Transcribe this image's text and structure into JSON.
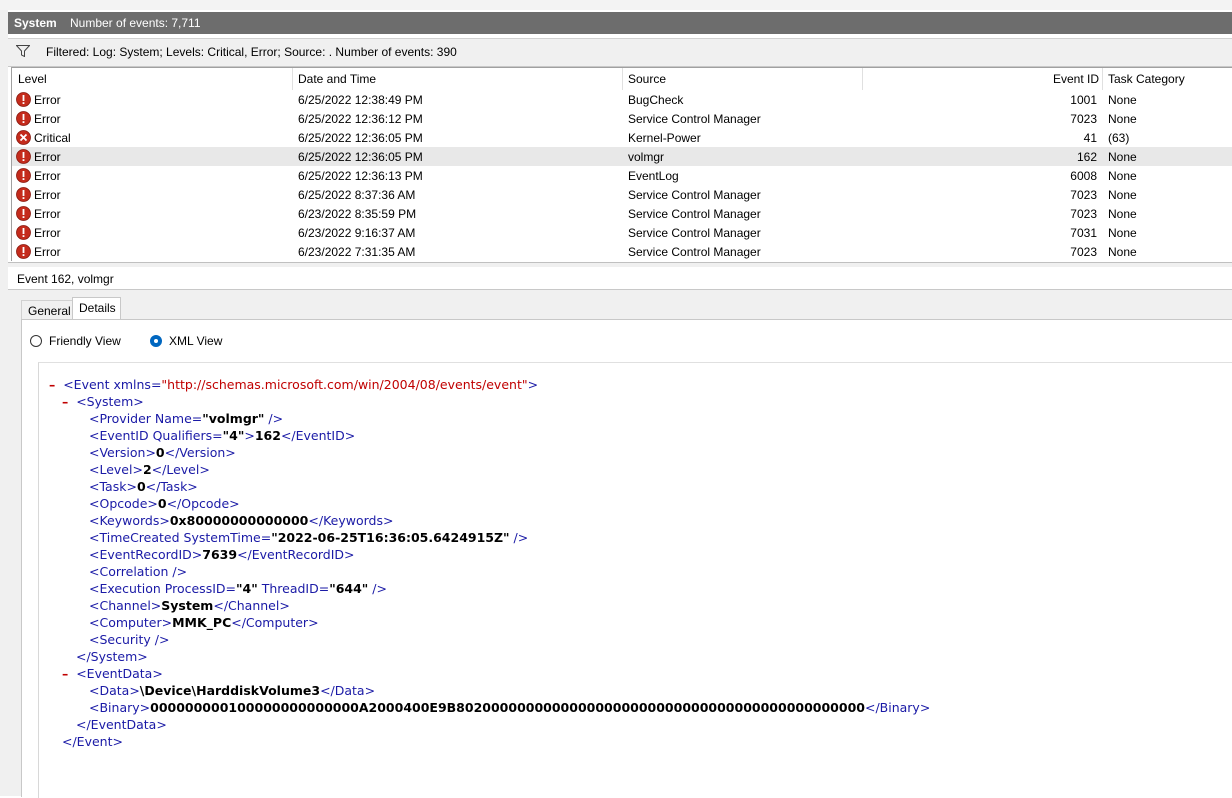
{
  "title_bar": {
    "log_name": "System",
    "event_count": "Number of events: 7,711"
  },
  "filter_bar": {
    "text": "Filtered: Log: System; Levels: Critical, Error; Source: . Number of events: 390"
  },
  "columns": [
    "Level",
    "Date and Time",
    "Source",
    "Event ID",
    "Task Category"
  ],
  "rows": [
    {
      "level": "Error",
      "date": "6/25/2022 12:38:49 PM",
      "source": "BugCheck",
      "event_id": "1001",
      "task": "None"
    },
    {
      "level": "Error",
      "date": "6/25/2022 12:36:12 PM",
      "source": "Service Control Manager",
      "event_id": "7023",
      "task": "None"
    },
    {
      "level": "Critical",
      "date": "6/25/2022 12:36:05 PM",
      "source": "Kernel-Power",
      "event_id": "41",
      "task": "(63)"
    },
    {
      "level": "Error",
      "date": "6/25/2022 12:36:05 PM",
      "source": "volmgr",
      "event_id": "162",
      "task": "None"
    },
    {
      "level": "Error",
      "date": "6/25/2022 12:36:13 PM",
      "source": "EventLog",
      "event_id": "6008",
      "task": "None"
    },
    {
      "level": "Error",
      "date": "6/25/2022 8:37:36 AM",
      "source": "Service Control Manager",
      "event_id": "7023",
      "task": "None"
    },
    {
      "level": "Error",
      "date": "6/23/2022 8:35:59 PM",
      "source": "Service Control Manager",
      "event_id": "7023",
      "task": "None"
    },
    {
      "level": "Error",
      "date": "6/23/2022 9:16:37 AM",
      "source": "Service Control Manager",
      "event_id": "7031",
      "task": "None"
    },
    {
      "level": "Error",
      "date": "6/23/2022 7:31:35 AM",
      "source": "Service Control Manager",
      "event_id": "7023",
      "task": "None"
    }
  ],
  "selected_row_index": 3,
  "event_header": "Event 162, volmgr",
  "tabs": {
    "general": "General",
    "details": "Details"
  },
  "view_options": {
    "friendly": "Friendly View",
    "xml": "XML View",
    "selected": "xml"
  },
  "xml": {
    "collapse_glyph": "–",
    "event_open": "<Event xmlns=",
    "event_xmlns_value": "\"http://schemas.microsoft.com/win/2004/08/events/event\"",
    "gt": ">",
    "system_open": "<System>",
    "provider_tag": "<Provider Name=",
    "provider_value": "\"volmgr\"",
    "selfclose": " />",
    "eventid_tag": "<EventID Qualifiers=",
    "eventid_qual": "\"4\"",
    "eventid_value": "162",
    "eventid_close": "</EventID>",
    "version_open": "<Version>",
    "version_value": "0",
    "version_close": "</Version>",
    "level_open": "<Level>",
    "level_value": "2",
    "level_close": "</Level>",
    "task_open": "<Task>",
    "task_value": "0",
    "task_close": "</Task>",
    "opcode_open": "<Opcode>",
    "opcode_value": "0",
    "opcode_close": "</Opcode>",
    "keywords_open": "<Keywords>",
    "keywords_value": "0x80000000000000",
    "keywords_close": "</Keywords>",
    "timecreated_tag": "<TimeCreated SystemTime=",
    "timecreated_value": "\"2022-06-25T16:36:05.6424915Z\"",
    "recordid_open": "<EventRecordID>",
    "recordid_value": "7639",
    "recordid_close": "</EventRecordID>",
    "correlation": "<Correlation />",
    "execution_tag": "<Execution ProcessID=",
    "execution_pid": "\"4\"",
    "execution_tid_attr": " ThreadID=",
    "execution_tid": "\"644\"",
    "channel_open": "<Channel>",
    "channel_value": "System",
    "channel_close": "</Channel>",
    "computer_open": "<Computer>",
    "computer_value": "MMK_PC",
    "computer_close": "</Computer>",
    "security": "<Security />",
    "system_close": "</System>",
    "eventdata_open": "<EventData>",
    "data_open": "<Data>",
    "data_value": "\\Device\\HarddiskVolume3",
    "data_close": "</Data>",
    "binary_open": "<Binary>",
    "binary_value": "000000000100000000000000A2000400E9B80200000000000000000000000000000000000000000000",
    "binary_close": "</Binary>",
    "eventdata_close": "</EventData>",
    "event_close": "</Event>"
  },
  "colors": {
    "title_bar_bg": "#6d6d6d",
    "xml_tag": "#1a1aa6",
    "xml_attr_value": "#c00000",
    "error_icon": "#c42b1c"
  }
}
